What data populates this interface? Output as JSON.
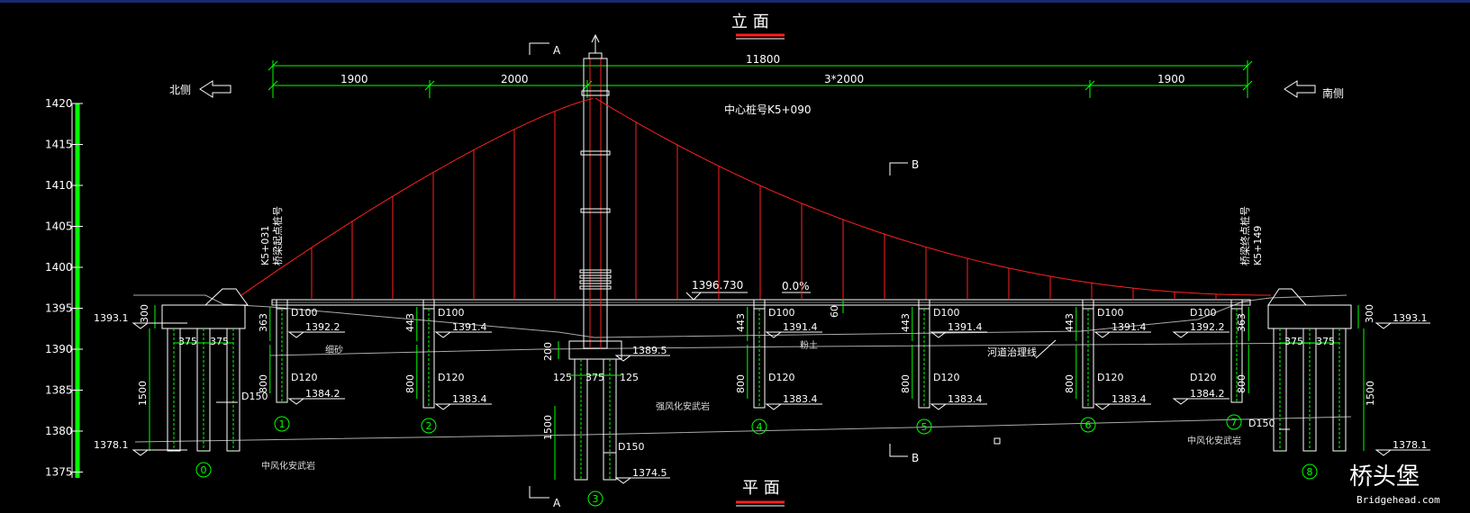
{
  "titles": {
    "elevation": "立 面",
    "plan": "平 面"
  },
  "directions": {
    "north": "北侧",
    "south": "南侧"
  },
  "section_marks": {
    "a_top": "A",
    "a_bottom": "A",
    "b_top": "B",
    "b_bottom": "B"
  },
  "center_station": "中心桩号K5+090",
  "start_station": {
    "label": "桥梁起点桩号",
    "value": "K5+031"
  },
  "end_station": {
    "label": "桥梁终点桩号",
    "value": "K5+149"
  },
  "dims_top": {
    "total": "11800",
    "s1": "1900",
    "s2": "2000",
    "s3": "3*2000",
    "s4": "1900"
  },
  "deck": {
    "elevation": "1396.730",
    "slope": "0.0%",
    "depth": "60"
  },
  "scale_ticks": [
    "1420",
    "1415",
    "1410",
    "1405",
    "1400",
    "1395",
    "1390",
    "1385",
    "1380",
    "1375"
  ],
  "piers": [
    {
      "id": "0"
    },
    {
      "id": "1"
    },
    {
      "id": "2"
    },
    {
      "id": "3"
    },
    {
      "id": "4"
    },
    {
      "id": "5"
    },
    {
      "id": "6"
    },
    {
      "id": "7"
    },
    {
      "id": "8"
    }
  ],
  "labels": {
    "d100": "D100",
    "d120": "D120",
    "d150": "D150",
    "a0_top": "1393.1",
    "a0_bottom": "1378.1",
    "a8_top": "1393.1",
    "a8_bottom": "1378.1",
    "p1_top": "1392.2",
    "p1_bottom": "1384.2",
    "p7_top": "1392.2",
    "p7_bottom": "1384.2",
    "p2_top": "1391.4",
    "p4_top": "1391.4",
    "p5_top": "1391.4",
    "p6_top": "1391.4",
    "p2_bottom": "1383.4",
    "p4_bottom": "1383.4",
    "p5_bottom": "1383.4",
    "p6_bottom": "1383.4",
    "p3_cap": "1389.5",
    "p3_bottom": "1374.5",
    "dim300": "300",
    "dim375": "375",
    "dim1500": "1500",
    "dim363": "363",
    "dim800": "800",
    "dim443": "443",
    "dim200": "200",
    "dim125": "125"
  },
  "geology": {
    "silt": "细砂",
    "soil": "粉土",
    "strong_weathered": "强风化安武岩",
    "mid_weathered_left": "中风化安武岩",
    "mid_weathered_right": "中风化安武岩",
    "river_line": "河道治理线"
  },
  "watermark": {
    "cn": "桥头堡",
    "url": "Bridgehead.com"
  },
  "colors": {
    "background": "#000000",
    "cable": "#ff2020",
    "dimension": "#00ff00",
    "outline": "#ffffff",
    "frame": "#1a2a6e"
  }
}
